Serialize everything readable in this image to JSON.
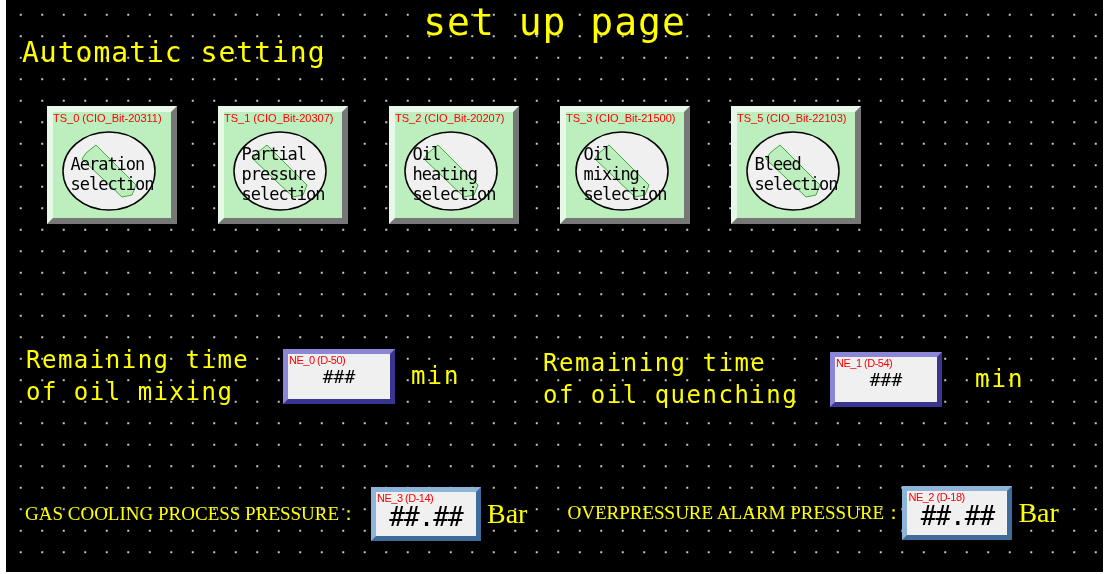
{
  "title": "set up page",
  "section_title": "Automatic setting",
  "switches": [
    {
      "tag": "TS_0 (CIO_Bit-20311)",
      "label": "Aeration\nselection",
      "on": false
    },
    {
      "tag": "TS_1 (CIO_Bit-20307)",
      "label": "Partial\npressure\nselection",
      "on": false
    },
    {
      "tag": "TS_2 (CIO_Bit-20207)",
      "label": "Oil\nheating\nselection",
      "on": false
    },
    {
      "tag": "TS_3 (CIO_Bit-21500)",
      "label": "Oil\nmixing\nselection",
      "on": false
    },
    {
      "tag": "TS_5 (CIO_Bit-22103)",
      "label": "Bleed\nselection",
      "on": false
    }
  ],
  "timers": [
    {
      "label": "Remaining time\nof oil mixing",
      "tag": "NE_0 (D-50)",
      "value": "###",
      "unit": "min"
    },
    {
      "label": "Remaining time\nof oil quenching",
      "tag": "NE_1 (D-54)",
      "value": "###",
      "unit": "min"
    }
  ],
  "pressures": [
    {
      "label": "GAS COOLING PROCESS PRESSURE：",
      "tag": "NE_3 (D-14)",
      "value": "##.##",
      "unit": "Bar"
    },
    {
      "label": "OVERPRESSURE ALARM PRESSURE：",
      "tag": "NE_2 (D-18)",
      "value": "##.##",
      "unit": "Bar"
    }
  ]
}
